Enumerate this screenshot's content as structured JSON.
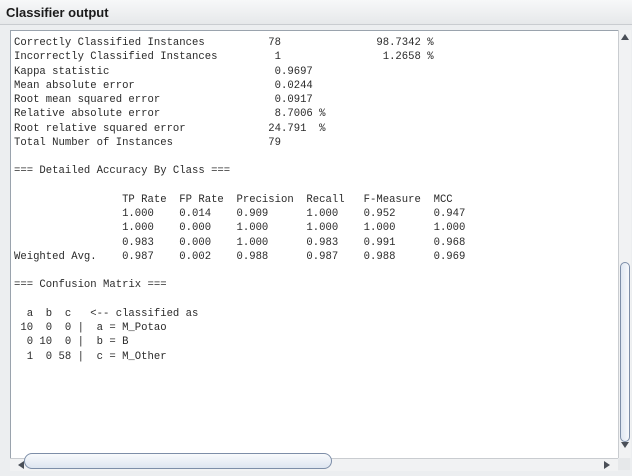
{
  "panel": {
    "title": "Classifier output"
  },
  "output_lines": [
    "Correctly Classified Instances          78               98.7342 %",
    "Incorrectly Classified Instances         1                1.2658 %",
    "Kappa statistic                          0.9697",
    "Mean absolute error                      0.0244",
    "Root mean squared error                  0.0917",
    "Relative absolute error                  8.7006 %",
    "Root relative squared error             24.791  %",
    "Total Number of Instances               79",
    "",
    "=== Detailed Accuracy By Class ===",
    "",
    "                 TP Rate  FP Rate  Precision  Recall   F-Measure  MCC",
    "                 1.000    0.014    0.909      1.000    0.952      0.947",
    "                 1.000    0.000    1.000      1.000    1.000      1.000",
    "                 0.983    0.000    1.000      0.983    0.991      0.968",
    "Weighted Avg.    0.987    0.002    0.988      0.987    0.988      0.969",
    "",
    "=== Confusion Matrix ===",
    "",
    "  a  b  c   <-- classified as",
    " 10  0  0 |  a = M_Potao",
    "  0 10  0 |  b = B",
    "  1  0 58 |  c = M_Other"
  ]
}
